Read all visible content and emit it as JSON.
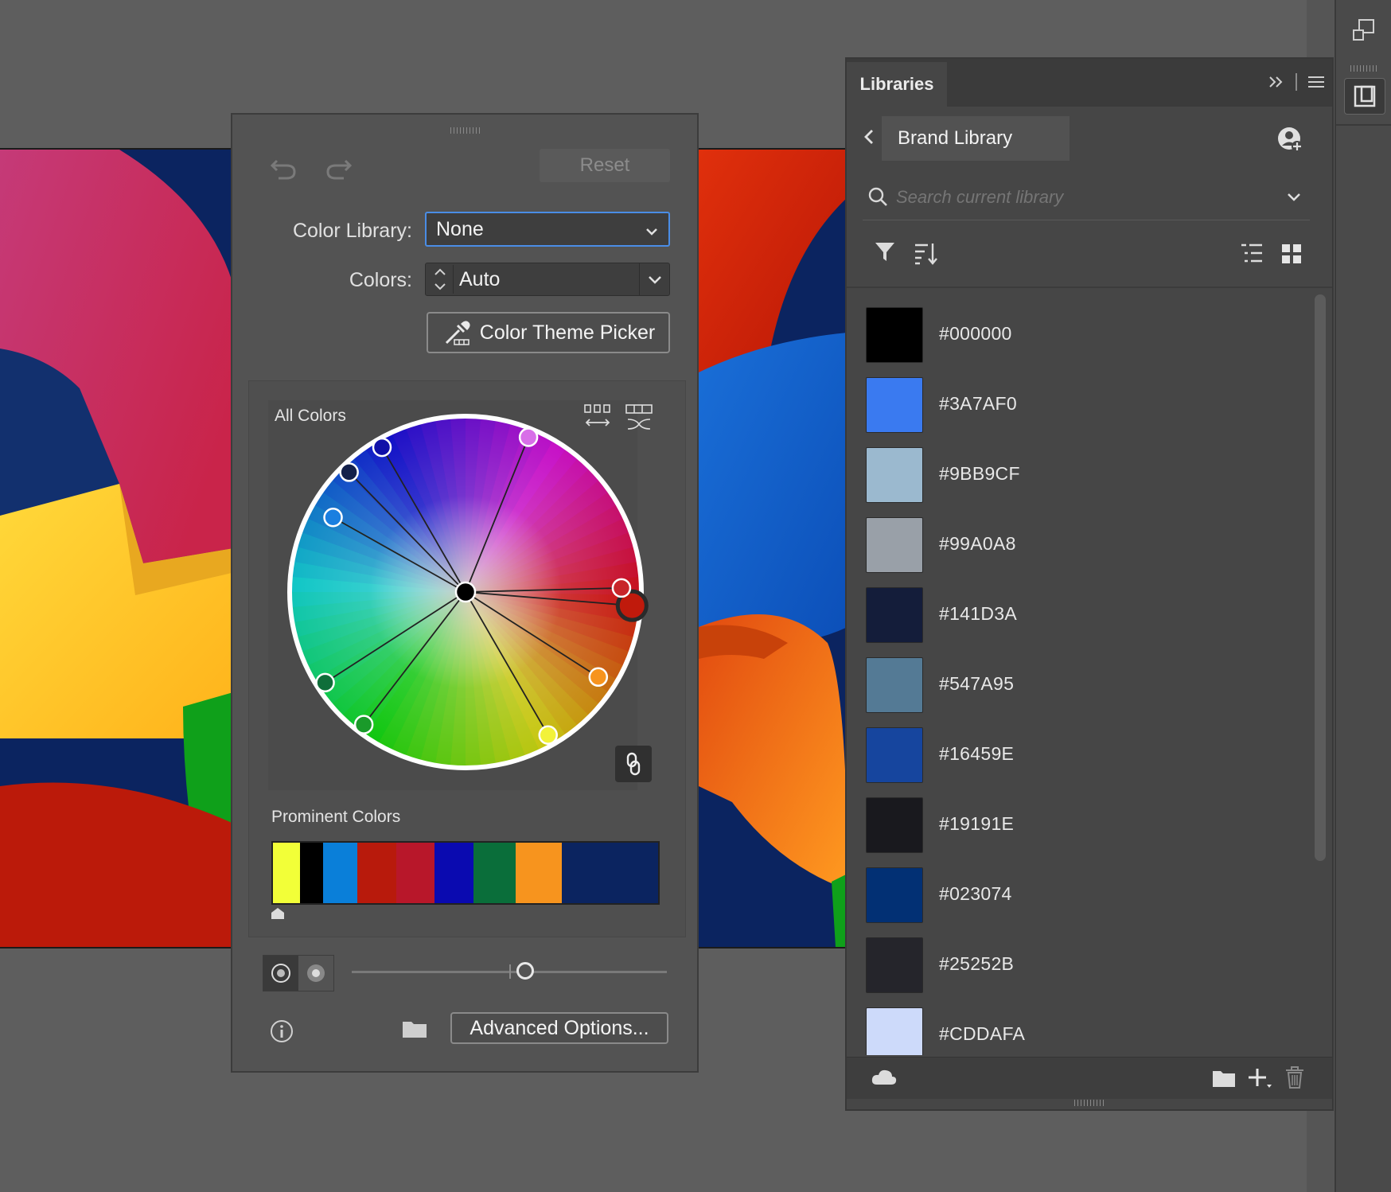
{
  "recolor_panel": {
    "reset_label": "Reset",
    "color_library_label": "Color Library:",
    "color_library_value": "None",
    "colors_label": "Colors:",
    "colors_value": "Auto",
    "color_theme_picker_label": "Color Theme Picker",
    "all_colors_label": "All Colors",
    "prominent_colors_label": "Prominent Colors",
    "prominent_colors": [
      {
        "color": "#f2ff38",
        "fraction": 0.07
      },
      {
        "color": "#000000",
        "fraction": 0.06
      },
      {
        "color": "#0a7fd9",
        "fraction": 0.09
      },
      {
        "color": "#b81a0c",
        "fraction": 0.1
      },
      {
        "color": "#b8172a",
        "fraction": 0.1
      },
      {
        "color": "#0a0ab0",
        "fraction": 0.1
      },
      {
        "color": "#0a6e3a",
        "fraction": 0.11
      },
      {
        "color": "#f7941e",
        "fraction": 0.12
      },
      {
        "color": "#0b2460",
        "fraction": 0.25
      }
    ],
    "advanced_options_label": "Advanced Options...",
    "brightness_slider_value": 0.5,
    "wheel_nodes": [
      {
        "color": "#f2f23a",
        "selected": false
      },
      {
        "color": "#f7941e",
        "selected": false
      },
      {
        "color": "#c01a0c",
        "selected": true
      },
      {
        "color": "#c8262a",
        "selected": false
      },
      {
        "color": "#d86ee8",
        "selected": false
      },
      {
        "color": "#1a9a2a",
        "selected": false
      },
      {
        "color": "#0f6e3a",
        "selected": false
      },
      {
        "color": "#1a7fe0",
        "selected": false
      },
      {
        "color": "#13204a",
        "selected": false
      },
      {
        "color": "#1010a8",
        "selected": false
      }
    ]
  },
  "libraries_panel": {
    "tab_label": "Libraries",
    "library_name": "Brand Library",
    "search_placeholder": "Search current library",
    "swatches": [
      {
        "label": "#000000",
        "color": "#000000"
      },
      {
        "label": "#3A7AF0",
        "color": "#3A7AF0"
      },
      {
        "label": "#9BB9CF",
        "color": "#9BB9CF"
      },
      {
        "label": "#99A0A8",
        "color": "#99A0A8"
      },
      {
        "label": "#141D3A",
        "color": "#141D3A"
      },
      {
        "label": "#547A95",
        "color": "#547A95"
      },
      {
        "label": "#16459E",
        "color": "#16459E"
      },
      {
        "label": "#19191E",
        "color": "#19191E"
      },
      {
        "label": "#023074",
        "color": "#023074"
      },
      {
        "label": "#25252B",
        "color": "#25252B"
      },
      {
        "label": "#CDDAFA",
        "color": "#CDDAFA"
      }
    ]
  },
  "icons": [
    "undo-icon",
    "redo-icon",
    "chevron-down-icon",
    "stepper-icon",
    "eyedropper-icon",
    "arrange-colors-icon",
    "randomize-colors-icon",
    "link-icon",
    "info-icon",
    "folder-icon",
    "back-icon",
    "add-user-icon",
    "search-icon",
    "filter-icon",
    "sort-icon",
    "list-view-icon",
    "grid-view-icon",
    "cloud-icon",
    "new-folder-icon",
    "add-icon",
    "trash-icon",
    "panel-menu-icon",
    "collapse-icon",
    "arrange-documents-icon",
    "libraries-panel-icon"
  ]
}
